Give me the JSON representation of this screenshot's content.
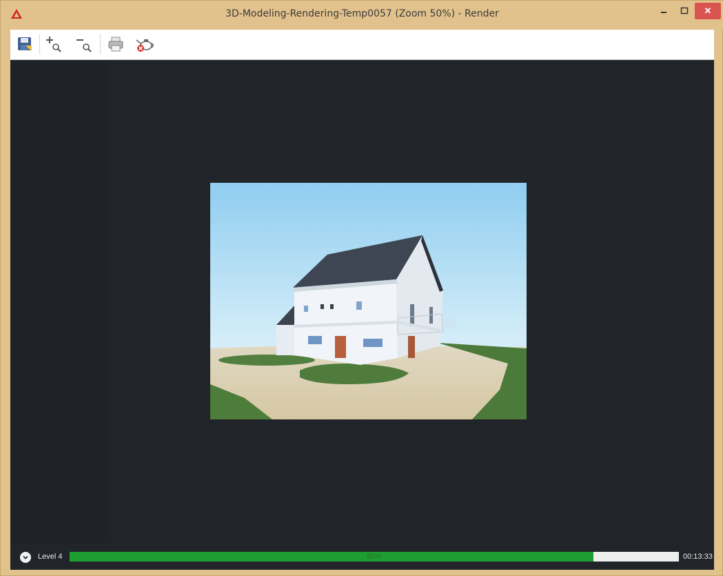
{
  "window": {
    "title": "3D-Modeling-Rendering-Temp0057 (Zoom 50%) - Render",
    "controls": {
      "minimize_icon": "minimize-icon",
      "maximize_icon": "maximize-icon",
      "close_glyph": "✕"
    },
    "accent_color": "#e2c28c",
    "close_color": "#d9534f"
  },
  "toolbar": {
    "buttons": [
      {
        "name": "save-button",
        "icon": "save-icon"
      },
      {
        "name": "zoom-in-button",
        "icon": "zoom-in-icon"
      },
      {
        "name": "zoom-out-button",
        "icon": "zoom-out-icon"
      },
      {
        "name": "print-button",
        "icon": "printer-icon"
      },
      {
        "name": "cancel-render-button",
        "icon": "teapot-cancel-icon"
      }
    ]
  },
  "render": {
    "image_subject": "rendered-house"
  },
  "status": {
    "level_label": "Level 4",
    "progress_percent": 86,
    "progress_text": "86%",
    "elapsed_time": "00:13:33",
    "progress_color": "#1e9e30"
  }
}
